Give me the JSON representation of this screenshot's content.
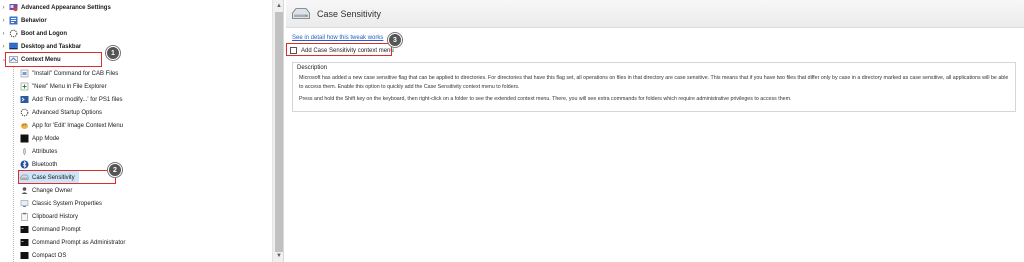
{
  "tree": {
    "top_items": [
      {
        "label": "Advanced Appearance Settings",
        "icon": "appearance-icon"
      },
      {
        "label": "Behavior",
        "icon": "behavior-icon"
      },
      {
        "label": "Boot and Logon",
        "icon": "boot-icon"
      },
      {
        "label": "Desktop and Taskbar",
        "icon": "desktop-icon"
      },
      {
        "label": "Context Menu",
        "icon": "context-menu-icon"
      }
    ],
    "children": [
      {
        "label": "\"Install\" Command for CAB Files"
      },
      {
        "label": "\"New\" Menu in File Explorer"
      },
      {
        "label": "Add 'Run or modify...' for PS1 files"
      },
      {
        "label": "Advanced Startup Options"
      },
      {
        "label": "App for 'Edit' Image Context Menu"
      },
      {
        "label": "App Mode"
      },
      {
        "label": "Attributes"
      },
      {
        "label": "Bluetooth"
      },
      {
        "label": "Case Sensitivity"
      },
      {
        "label": "Change Owner"
      },
      {
        "label": "Classic System Properties"
      },
      {
        "label": "Clipboard History"
      },
      {
        "label": "Command Prompt"
      },
      {
        "label": "Command Prompt as Administrator"
      },
      {
        "label": "Compact OS"
      }
    ]
  },
  "steps": {
    "one": "1",
    "two": "2",
    "three": "3"
  },
  "right": {
    "title": "Case Sensitivity",
    "tweak_link": "See in detail how this tweak works",
    "option_label": "Add Case Sensitivity context menu",
    "description_title": "Description",
    "description_p1": "Microsoft has added a new case sensitive flag that can be applied to directories. For directories that have this flag set, all operations on files in that directory are case sensitive. This means that if you have two files that differ only by case in a directory marked as case sensitive, all applications will be able to access them. Enable this option to quickly add the Case Sensitivity context menu to folders.",
    "description_p2": "Press and hold the Shift key on the keyboard, then right-click on a folder to see the extended context menu. There, you will see extra commands for folders which require administrative privileges to access them."
  },
  "colors": {
    "highlight": "#e02b2b",
    "link": "#1f5fc7",
    "selected_bg": "#cce4f7"
  }
}
